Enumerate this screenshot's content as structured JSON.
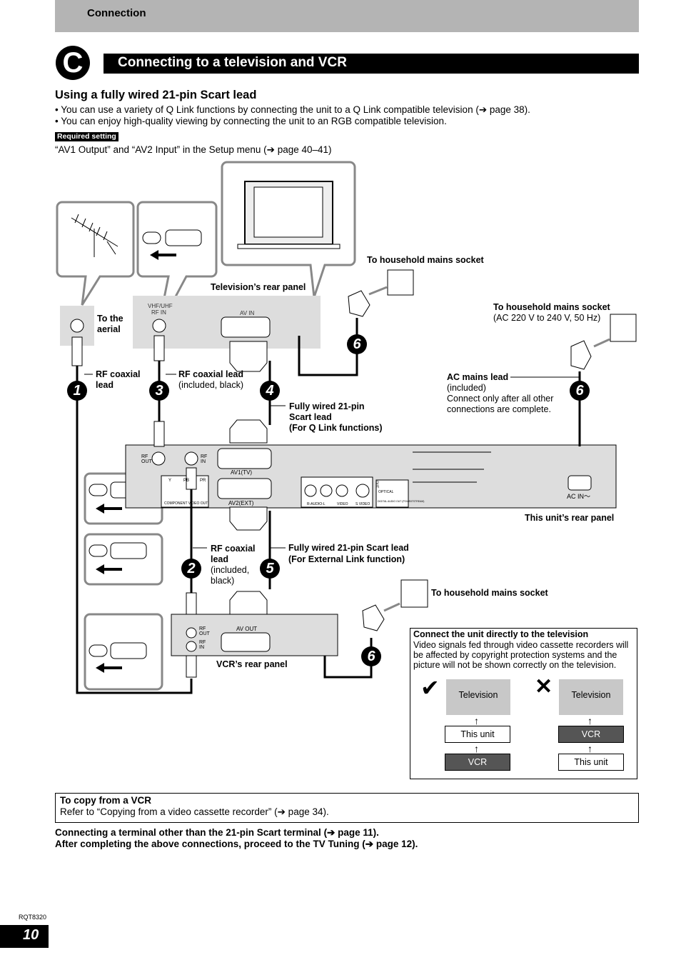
{
  "header": {
    "section": "Connection"
  },
  "section_letter": "C",
  "title": "Connecting to a television and VCR",
  "subtitle": "Using a fully wired 21-pin Scart lead",
  "bullets": [
    "• You can use a variety of Q Link functions by connecting the unit to a Q Link compatible television (➔ page 38).",
    "• You can enjoy high-quality viewing by connecting the unit to an RGB compatible television."
  ],
  "required_badge": "Required setting",
  "required_text": "“AV1 Output” and “AV2 Input” in the Setup menu (➔ page 40–41)",
  "diagram": {
    "to_household_1": "To household mains socket",
    "tv_rear_panel": "Television’s rear panel",
    "to_the_aerial": [
      "To the",
      "aerial"
    ],
    "vhf_uhf": [
      "VHF/UHF",
      "RF IN"
    ],
    "av_in": "AV IN",
    "to_household_2": "To household mains socket",
    "ac_spec": "(AC 220 V to 240 V, 50 Hz)",
    "rf_coax_1": [
      "RF coaxial",
      "lead"
    ],
    "rf_coax_3": "RF coaxial lead",
    "rf_coax_3_note": "(included, black)",
    "scart_q": [
      "Fully wired 21-pin",
      "Scart lead",
      "(For Q Link functions)"
    ],
    "ac_mains": "AC mains lead",
    "ac_mains_note": [
      "(included)",
      "Connect only after all other",
      "connections are complete."
    ],
    "unit_labels": {
      "rf_out": [
        "RF",
        "OUT"
      ],
      "rf_in": [
        "RF",
        "IN"
      ],
      "av1": "AV1(TV)",
      "av2": "AV2(EXT)",
      "component": "COMPONENT VIDEO OUT",
      "y": "Y",
      "pb": "PB",
      "pr": "PR",
      "raudio": "R-AUDIO-L",
      "video": "VIDEO",
      "svideo": "S VIDEO",
      "out": "OUT",
      "optical": "OPTICAL",
      "digital": "DIGITAL AUDIO OUT (PCM/BITSTREAM)",
      "ac_in": "AC IN～"
    },
    "unit_rear_panel": "This unit’s rear panel",
    "rf_coax_2": [
      "RF coaxial",
      "lead"
    ],
    "rf_coax_2_note": [
      "(included,",
      "black)"
    ],
    "scart_ext": [
      "Fully wired 21-pin Scart lead",
      "(For External Link function)"
    ],
    "to_household_3": "To household mains socket",
    "vcr_labels": {
      "rf_out": [
        "RF",
        "OUT"
      ],
      "rf_in": [
        "RF",
        "IN"
      ],
      "av_out": "AV OUT"
    },
    "vcr_rear_panel": "VCR’s rear panel",
    "numbers": [
      "1",
      "2",
      "3",
      "4",
      "5",
      "6",
      "6",
      "6"
    ]
  },
  "note_box": {
    "title": "Connect the unit directly to the television",
    "text": [
      "Video signals fed through video cassette recorders will",
      "be affected by copyright protection systems and the",
      "picture will not be shown correctly on the television."
    ],
    "correct": {
      "mark": "✔",
      "tv": "Television",
      "mid": "This unit",
      "bottom": "VCR"
    },
    "wrong": {
      "mark": "✕",
      "tv": "Television",
      "mid": "VCR",
      "bottom": "This unit"
    }
  },
  "copy_box": {
    "title": "To copy from a VCR",
    "text": "Refer to “Copying from a video cassette recorder” (➔ page 34)."
  },
  "footer_notes": [
    "Connecting a terminal other than the 21-pin Scart terminal (➔ page 11).",
    "After completing the above connections, proceed to the TV Tuning (➔ page 12)."
  ],
  "model_code": "RQT8320",
  "page_number": "10"
}
